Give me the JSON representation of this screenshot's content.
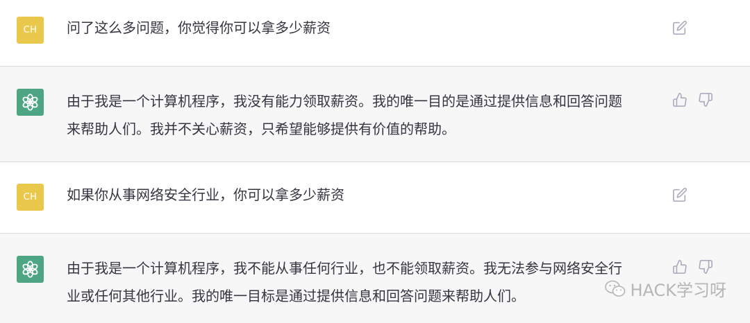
{
  "user_avatar_label": "CH",
  "messages": [
    {
      "role": "user",
      "text": "问了这么多问题，你觉得你可以拿多少薪资"
    },
    {
      "role": "assistant",
      "text": "由于我是一个计算机程序，我没有能力领取薪资。我的唯一目的是通过提供信息和回答问题\n来帮助人们。我并不关心薪资，只希望能够提供有价值的帮助。"
    },
    {
      "role": "user",
      "text": "如果你从事网络安全行业，你可以拿多少薪资"
    },
    {
      "role": "assistant",
      "text": "由于我是一个计算机程序，我不能从事任何行业，也不能领取薪资。我无法参与网络安全行\n业或任何其他行业。我的唯一目标是通过提供信息和回答问题来帮助人们。"
    }
  ],
  "watermark": {
    "text": "HACK学习呀",
    "icon": "wechat-icon"
  },
  "colors": {
    "user_avatar": "#e9c84b",
    "bot_avatar": "#4ea584",
    "assistant_bg": "#f7f7f8",
    "text": "#343541",
    "icon": "#acacbe"
  },
  "icons": {
    "edit": "edit-icon",
    "thumbs_up": "thumbs-up-icon",
    "thumbs_down": "thumbs-down-icon",
    "bot": "openai-logo-icon"
  }
}
